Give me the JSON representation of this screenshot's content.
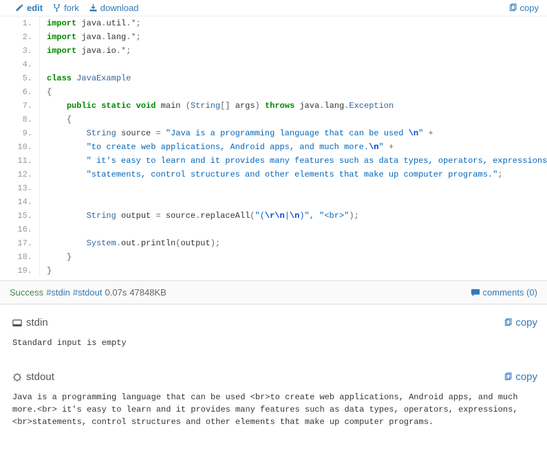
{
  "toolbar": {
    "edit": "edit",
    "fork": "fork",
    "download": "download",
    "copy": "copy"
  },
  "code": {
    "lines": [
      {
        "n": "1.",
        "html": "<span class='kw'>import</span> java<span class='pun'>.</span>util<span class='pun'>.*;</span>"
      },
      {
        "n": "2.",
        "html": "<span class='kw'>import</span> java<span class='pun'>.</span>lang<span class='pun'>.*;</span>"
      },
      {
        "n": "3.",
        "html": "<span class='kw'>import</span> java<span class='pun'>.</span>io<span class='pun'>.*;</span>"
      },
      {
        "n": "4.",
        "html": ""
      },
      {
        "n": "5.",
        "html": "<span class='kw'>class</span> <span class='typ'>JavaExample</span>"
      },
      {
        "n": "6.",
        "html": "<span class='pun'>{</span>"
      },
      {
        "n": "7.",
        "html": "    <span class='kw'>public</span> <span class='kw'>static</span> <span class='kw'>void</span> main <span class='pun'>(</span><span class='typ'>String</span><span class='pun'>[]</span> args<span class='pun'>)</span> <span class='kw'>throws</span> java<span class='pun'>.</span>lang<span class='pun'>.</span><span class='typ'>Exception</span>"
      },
      {
        "n": "8.",
        "html": "    <span class='pun'>{</span>"
      },
      {
        "n": "9.",
        "html": "        <span class='typ'>String</span> source <span class='pun'>=</span> <span class='str'>\"Java is a programming language that can be used <span class='esc'>\\n</span>\"</span> <span class='pun'>+</span>"
      },
      {
        "n": "10.",
        "html": "        <span class='str'>\"to create web applications, Android apps, and much more.<span class='esc'>\\n</span>\"</span> <span class='pun'>+</span>"
      },
      {
        "n": "11.",
        "html": "        <span class='str'>\" it's easy to learn and it provides many features such as data types, operators, expressions, <span class='esc'>\\n</span>\"</span> <span class='pun'>+</span>"
      },
      {
        "n": "12.",
        "html": "        <span class='str'>\"statements, control structures and other elements that make up computer programs.\"</span><span class='pun'>;</span>"
      },
      {
        "n": "13.",
        "html": ""
      },
      {
        "n": "14.",
        "html": ""
      },
      {
        "n": "15.",
        "html": "        <span class='typ'>String</span> output <span class='pun'>=</span> source<span class='pun'>.</span>replaceAll<span class='pun'>(</span><span class='str'>\"(<span class='esc'>\\r\\n</span>|<span class='esc'>\\n</span>)\"</span><span class='pun'>,</span> <span class='str'>\"&lt;br&gt;\"</span><span class='pun'>);</span>"
      },
      {
        "n": "16.",
        "html": ""
      },
      {
        "n": "17.",
        "html": "        <span class='typ'>System</span><span class='pun'>.</span>out<span class='pun'>.</span>println<span class='pun'>(</span>output<span class='pun'>);</span>"
      },
      {
        "n": "18.",
        "html": "    <span class='pun'>}</span>"
      },
      {
        "n": "19.",
        "html": "<span class='pun'>}</span>"
      }
    ]
  },
  "status": {
    "success": "Success",
    "stdin_link": "#stdin",
    "stdout_link": "#stdout",
    "time": "0.07s",
    "memory": "47848KB",
    "comments_label": "comments (0)"
  },
  "stdin": {
    "title": "stdin",
    "copy": "copy",
    "body": "Standard input is empty"
  },
  "stdout": {
    "title": "stdout",
    "copy": "copy",
    "body": "Java is a programming language that can be used <br>to create web applications, Android apps, and much more.<br> it's easy to learn and it provides many features such as data types, operators, expressions, <br>statements, control structures and other elements that make up computer programs."
  }
}
